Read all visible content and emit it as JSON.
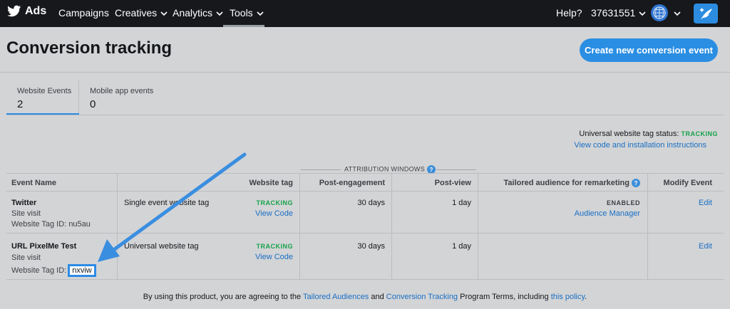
{
  "nav": {
    "brand": "Ads",
    "items": [
      "Campaigns",
      "Creatives",
      "Analytics",
      "Tools"
    ],
    "help": "Help?",
    "account": "37631551"
  },
  "page": {
    "title": "Conversion tracking",
    "create_button": "Create new conversion event"
  },
  "tabs": [
    {
      "label": "Website Events",
      "count": "2",
      "active": true
    },
    {
      "label": "Mobile app events",
      "count": "0",
      "active": false
    }
  ],
  "universal": {
    "status_label": "Universal website tag status:",
    "status_value": "TRACKING",
    "link": "View code and installation instructions"
  },
  "attribution_label": "ATTRIBUTION WINDOWS",
  "table": {
    "headers": [
      "Event Name",
      "Website tag",
      "Post-engagement",
      "Post-view",
      "Tailored audience for remarketing",
      "Modify Event"
    ],
    "rows": [
      {
        "name": "Twitter",
        "type": "Site visit",
        "tag_id_label": "Website Tag ID:",
        "tag_id": "nu5au",
        "tag_kind": "Single event website tag",
        "status": "TRACKING",
        "view_code": "View Code",
        "post_engagement": "30 days",
        "post_view": "1 day",
        "audience_status": "ENABLED",
        "audience_link": "Audience Manager",
        "edit": "Edit"
      },
      {
        "name": "URL PixelMe Test",
        "type": "Site visit",
        "tag_id_label": "Website Tag ID:",
        "tag_id": "nxviw",
        "tag_kind": "Universal website tag",
        "status": "TRACKING",
        "view_code": "View Code",
        "post_engagement": "30 days",
        "post_view": "1 day",
        "edit": "Edit"
      }
    ]
  },
  "footer": {
    "pre": "By using this product, you are agreeing to the ",
    "link1": "Tailored Audiences",
    "mid1": " and ",
    "link2": "Conversion Tracking",
    "mid2": " Program Terms, including ",
    "link3": "this policy",
    "post": "."
  },
  "colors": {
    "accent": "#2a8ee3",
    "tracking_green": "#16a34a",
    "nav_bg": "#16181c",
    "annotation_arrow": "#3a8ee0"
  }
}
